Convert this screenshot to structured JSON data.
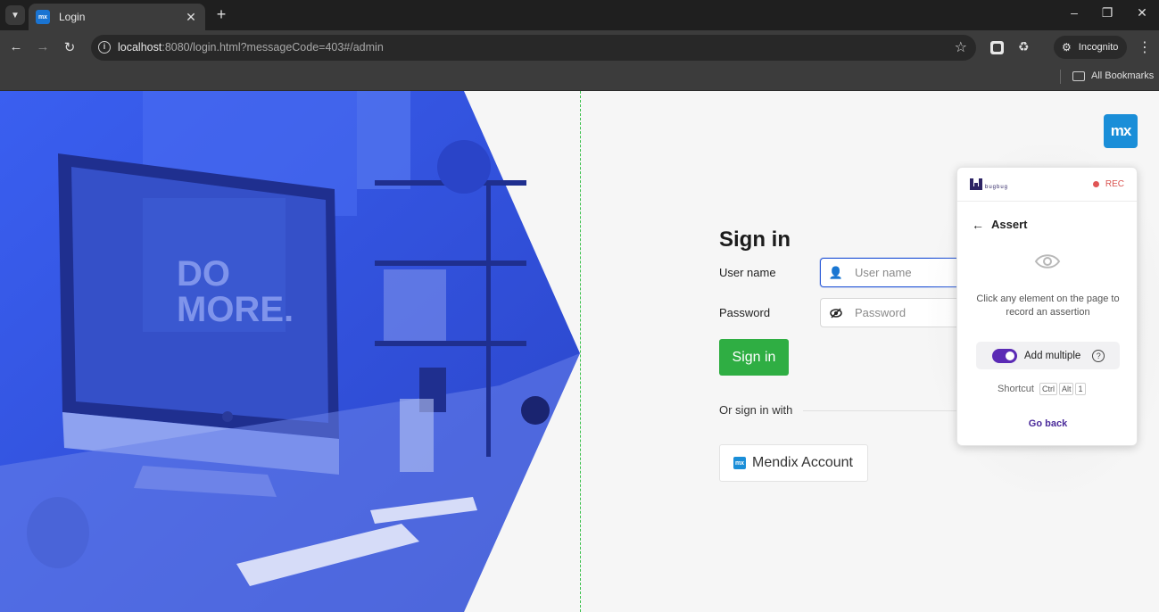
{
  "browser": {
    "tab_title": "Login",
    "tab_favicon_text": "mx",
    "url_host": "localhost",
    "url_rest": ":8080/login.html?messageCode=403#/admin",
    "incognito_label": "Incognito",
    "bookmarks_label": "All Bookmarks"
  },
  "page": {
    "logo_text": "mx",
    "hero_text_line1": "DO",
    "hero_text_line2": "MORE.",
    "title": "Sign in",
    "username_label": "User name",
    "username_placeholder": "User name",
    "password_label": "Password",
    "password_placeholder": "Password",
    "signin_button": "Sign in",
    "or_sign_in_with": "Or sign in with",
    "mendix_account_button": "Mendix Account",
    "mendix_icon_text": "mx"
  },
  "bugbug": {
    "logo_text": "bugbug",
    "rec_label": "REC",
    "title": "Assert",
    "hint": "Click any element on the page to record an assertion",
    "add_multiple_label": "Add multiple",
    "add_multiple_enabled": true,
    "help_icon_text": "?",
    "shortcut_label": "Shortcut",
    "shortcut_keys": [
      "Ctrl",
      "Alt",
      "1"
    ],
    "go_back": "Go back"
  },
  "colors": {
    "hero_blue": "#3557e6",
    "signin_green": "#2fae43",
    "mendix_blue": "#1a8ed8",
    "bugbug_purple": "#5b2bb5",
    "rec_red": "#e05555"
  },
  "icons": [
    "tab-search-icon",
    "close-icon",
    "plus-icon",
    "minimize-icon",
    "restore-icon",
    "window-close-icon",
    "back-arrow-icon",
    "forward-arrow-icon",
    "reload-icon",
    "site-info-icon",
    "star-icon",
    "extensions-icon",
    "incognito-icon",
    "kebab-menu-icon",
    "folder-icon",
    "user-icon",
    "password-eye-icon",
    "eye-icon",
    "help-icon"
  ]
}
